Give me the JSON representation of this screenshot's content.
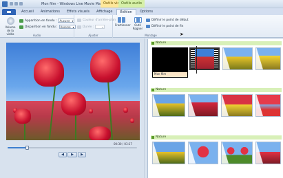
{
  "titlebar": {
    "title": "Mon film - Windows Live Movie Maker",
    "context_tab_1": "Outils vidéo",
    "context_tab_2": "Outils audio"
  },
  "ribbon_tabs": [
    "Accueil",
    "Animations",
    "Effets visuels",
    "Affichage",
    "Édition",
    "Options"
  ],
  "active_tab": "Édition",
  "ribbon": {
    "audio_group": {
      "volume_label": "Volume de la vidéo",
      "fade_in_label": "Apparition en fondu :",
      "fade_in_value": "Aucune",
      "fade_out_label": "Disparition en fondu :",
      "fade_out_value": "Aucune",
      "group_label": "Audio"
    },
    "adjust_group": {
      "bg_color_label": "Couleur d'arrière-plan",
      "duration_label": "Durée :",
      "group_label": "Ajuster"
    },
    "editing_group": {
      "split_label": "Fractionner",
      "trim_label": "Outil Rogner",
      "set_start_label": "Définir le point de début",
      "set_end_label": "Définir le point de fin",
      "group_label": "Montage"
    }
  },
  "preview": {
    "timecode": "00:30 / 03:17",
    "progress": 0.15,
    "prev_label": "◀",
    "play_label": "▶",
    "next_label": "▶"
  },
  "storyboard": {
    "groups": [
      {
        "label": "Nature"
      },
      {
        "label": "Nature"
      },
      {
        "label": "Nature"
      }
    ],
    "title_clip_label": "Mon film"
  },
  "colors": {
    "accent": "#2f64b7",
    "group_label_bg": "#d8f0b8",
    "tulip_red": "#c8102e"
  }
}
